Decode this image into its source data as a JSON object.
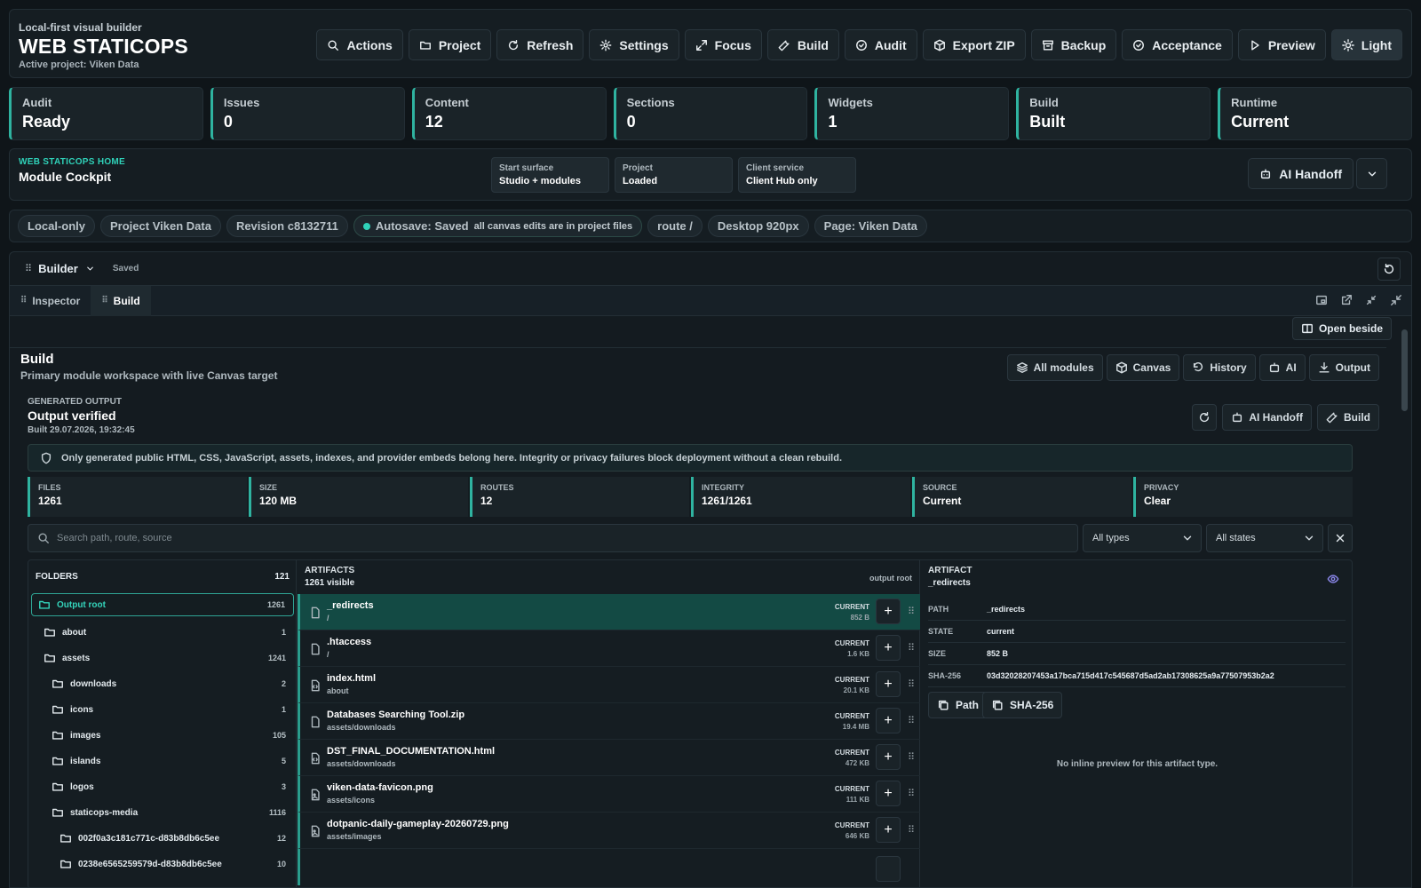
{
  "header": {
    "tagline": "Local-first visual builder",
    "title": "WEB STATICOPS",
    "subtitle": "Active project: Viken Data",
    "toolbar": [
      {
        "label": "Actions",
        "icon": "search-icon"
      },
      {
        "label": "Project",
        "icon": "folder-icon"
      },
      {
        "label": "Refresh",
        "icon": "refresh-icon"
      },
      {
        "label": "Settings",
        "icon": "gear-icon"
      },
      {
        "label": "Focus",
        "icon": "expand-icon"
      },
      {
        "label": "Build",
        "icon": "wrench-icon"
      },
      {
        "label": "Audit",
        "icon": "check-circle-icon"
      },
      {
        "label": "Export ZIP",
        "icon": "package-icon"
      },
      {
        "label": "Backup",
        "icon": "archive-icon"
      },
      {
        "label": "Acceptance",
        "icon": "check-circle-icon"
      },
      {
        "label": "Preview",
        "icon": "play-icon"
      },
      {
        "label": "Light",
        "icon": "sun-icon"
      }
    ]
  },
  "stats": [
    {
      "label": "Audit",
      "value": "Ready"
    },
    {
      "label": "Issues",
      "value": "0"
    },
    {
      "label": "Content",
      "value": "12"
    },
    {
      "label": "Sections",
      "value": "0"
    },
    {
      "label": "Widgets",
      "value": "1"
    },
    {
      "label": "Build",
      "value": "Built"
    },
    {
      "label": "Runtime",
      "value": "Current"
    }
  ],
  "home": {
    "kicker": "WEB STATICOPS HOME",
    "title": "Module Cockpit",
    "chips": [
      {
        "label": "Start surface",
        "value": "Studio + modules"
      },
      {
        "label": "Project",
        "value": "Loaded"
      },
      {
        "label": "Client service",
        "value": "Client Hub only"
      }
    ],
    "ai_handoff": "AI Handoff"
  },
  "pills": {
    "local": "Local-only",
    "project": "Project Viken Data",
    "revision": "Revision c8132711",
    "autosave": "Autosave: Saved",
    "autosave_note": "all canvas edits are in project files",
    "route": "route /",
    "viewport": "Desktop 920px",
    "page": "Page: Viken Data"
  },
  "builder": {
    "title": "Builder",
    "status": "Saved",
    "tabs": [
      "Inspector",
      "Build"
    ],
    "open_beside": "Open beside",
    "panel_title": "Build",
    "panel_subtitle": "Primary module workspace with live Canvas target",
    "modules": [
      {
        "label": "All modules",
        "icon": "layers-icon"
      },
      {
        "label": "Canvas",
        "icon": "cube-icon"
      },
      {
        "label": "History",
        "icon": "undo-icon"
      },
      {
        "label": "AI",
        "icon": "robot-icon"
      },
      {
        "label": "Output",
        "icon": "download-icon"
      }
    ]
  },
  "output": {
    "kicker": "GENERATED OUTPUT",
    "title": "Output verified",
    "built_at": "Built 29.07.2026, 19:32:45",
    "ai_handoff": "AI Handoff",
    "build": "Build",
    "note": "Only generated public HTML, CSS, JavaScript, assets, indexes, and provider embeds belong here. Integrity or privacy failures block deployment without a clean rebuild.",
    "metrics": [
      {
        "label": "FILES",
        "value": "1261"
      },
      {
        "label": "SIZE",
        "value": "120 MB"
      },
      {
        "label": "ROUTES",
        "value": "12"
      },
      {
        "label": "INTEGRITY",
        "value": "1261/1261"
      },
      {
        "label": "SOURCE",
        "value": "Current"
      },
      {
        "label": "PRIVACY",
        "value": "Clear"
      }
    ],
    "search_placeholder": "Search path, route, source",
    "type_filter": "All types",
    "state_filter": "All states"
  },
  "folders": {
    "header": "FOLDERS",
    "count": "121",
    "items": [
      {
        "name": "Output root",
        "count": "1261"
      },
      {
        "name": "about",
        "count": "1"
      },
      {
        "name": "assets",
        "count": "1241"
      },
      {
        "name": "downloads",
        "count": "2"
      },
      {
        "name": "icons",
        "count": "1"
      },
      {
        "name": "images",
        "count": "105"
      },
      {
        "name": "islands",
        "count": "5"
      },
      {
        "name": "logos",
        "count": "3"
      },
      {
        "name": "staticops-media",
        "count": "1116"
      },
      {
        "name": "002f0a3c181c771c-d83b8db6c5ee",
        "count": "12"
      },
      {
        "name": "0238e6565259579d-d83b8db6c5ee",
        "count": "10"
      }
    ]
  },
  "artifacts": {
    "header": "ARTIFACTS",
    "visible": "1261 visible",
    "scope": "output root",
    "rows": [
      {
        "name": "_redirects",
        "path": "/",
        "state": "CURRENT",
        "size": "852 B",
        "icon": "file-icon"
      },
      {
        "name": ".htaccess",
        "path": "/",
        "state": "CURRENT",
        "size": "1.6 KB",
        "icon": "file-icon"
      },
      {
        "name": "index.html",
        "path": "about",
        "state": "CURRENT",
        "size": "20.1 KB",
        "icon": "code-file-icon"
      },
      {
        "name": "Databases Searching Tool.zip",
        "path": "assets/downloads",
        "state": "CURRENT",
        "size": "19.4 MB",
        "icon": "file-icon"
      },
      {
        "name": "DST_FINAL_DOCUMENTATION.html",
        "path": "assets/downloads",
        "state": "CURRENT",
        "size": "472 KB",
        "icon": "code-file-icon"
      },
      {
        "name": "viken-data-favicon.png",
        "path": "assets/icons",
        "state": "CURRENT",
        "size": "111 KB",
        "icon": "image-file-icon"
      },
      {
        "name": "dotpanic-daily-gameplay-20260729.png",
        "path": "assets/images",
        "state": "CURRENT",
        "size": "646 KB",
        "icon": "image-file-icon"
      }
    ]
  },
  "detail": {
    "header": "ARTIFACT",
    "name": "_redirects",
    "fields": [
      {
        "key": "PATH",
        "value": "_redirects"
      },
      {
        "key": "STATE",
        "value": "current"
      },
      {
        "key": "SIZE",
        "value": "852 B"
      },
      {
        "key": "SHA-256",
        "value": "03d32028207453a17bca715d417c545687d5ad2ab17308625a9a77507953b2a2"
      }
    ],
    "copy_path": "Path",
    "copy_sha": "SHA-256",
    "no_preview": "No inline preview for this artifact type."
  }
}
